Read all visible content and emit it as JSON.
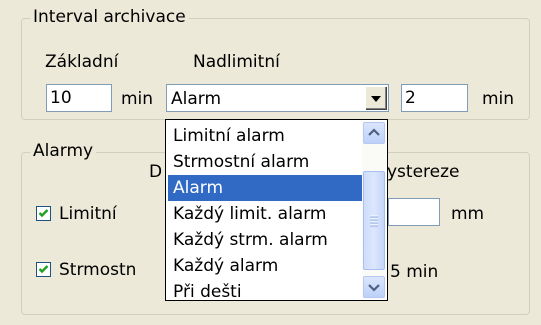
{
  "archive_group": {
    "title": "Interval archivace",
    "basic_label": "Základní",
    "overlimit_label": "Nadlimitní",
    "basic_value": "10",
    "basic_unit": "min",
    "combo_value": "Alarm",
    "overlimit_value": "2",
    "overlimit_unit": "min"
  },
  "alarms_group": {
    "title": "Alarmy",
    "col_d_partial": "D",
    "hysteresis_partial": "ystereze",
    "limit_label": "Limitní",
    "limit_checked": true,
    "steep_label": "Strmostn",
    "steep_checked": true,
    "hyst_unit": "mm",
    "steep_time_partial": "5 min"
  },
  "dropdown": {
    "options": [
      "Limitní alarm",
      "Strmostní alarm",
      "Alarm",
      "Každý limit. alarm",
      "Každý strm. alarm",
      "Každý alarm",
      "Při dešti"
    ],
    "selected_index": 2
  },
  "icons": {
    "combo_arrow": "chevron-down-icon",
    "scroll_up": "chevron-up-icon",
    "scroll_down": "chevron-down-icon",
    "checkmark": "checkmark-icon"
  },
  "colors": {
    "background": "#ece9d8",
    "selection": "#316ac5",
    "groupbox_border": "#d0d0bf",
    "field_border": "#7f9db9"
  }
}
